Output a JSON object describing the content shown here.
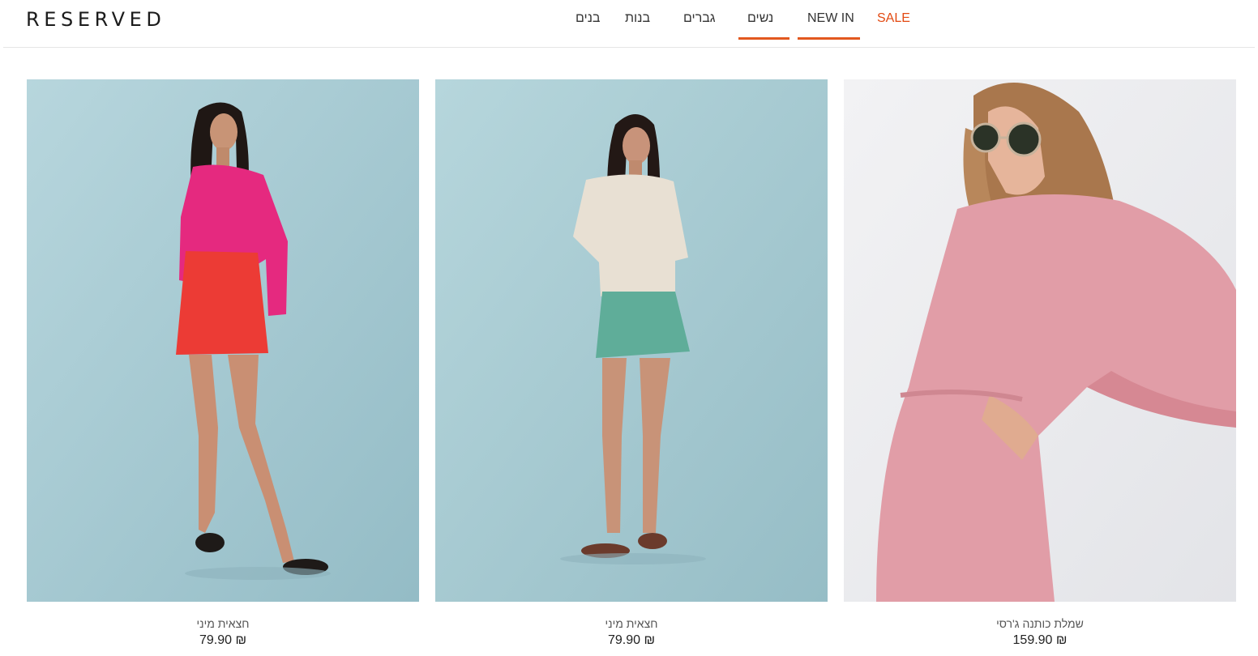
{
  "brand": {
    "logo_text": "RESERVED"
  },
  "nav": {
    "items": [
      {
        "label": "בנים"
      },
      {
        "label": "בנות"
      },
      {
        "label": "גברים"
      },
      {
        "label": "נשים",
        "active": true
      },
      {
        "label": "NEW IN",
        "active": true
      },
      {
        "label": "SALE",
        "color": "#e24a12"
      }
    ],
    "accent_color": "#e2581f"
  },
  "products": [
    {
      "name": "חצאית מיני",
      "price": "79.90 ₪",
      "image": "model in pink shirt and red mini skirt"
    },
    {
      "name": "חצאית מיני",
      "price": "79.90 ₪",
      "image": "model in beige t-shirt and green mini skirt"
    },
    {
      "name": "שמלת כותנה ג'רסי",
      "price": "159.90 ₪",
      "image": "model in pink cotton dress with sunglasses"
    }
  ]
}
